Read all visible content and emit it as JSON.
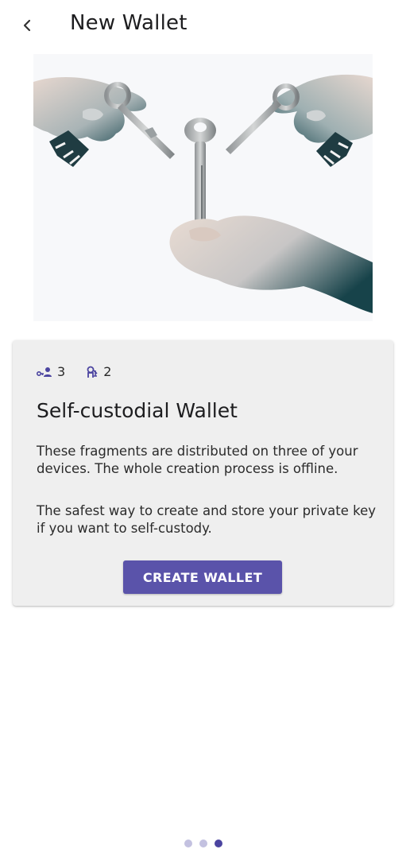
{
  "header": {
    "title": "New Wallet"
  },
  "card": {
    "stats": [
      {
        "icon": "key-person-icon",
        "value": "3"
      },
      {
        "icon": "signer-icon",
        "value": "2"
      }
    ],
    "title": "Self-custodial Wallet",
    "paragraph1": "These fragments are distributed on three of your devices. The whole creation process is offline.",
    "paragraph2": "The safest way to create and store your private key if you want to self-custody.",
    "create_label": "CREATE WALLET"
  },
  "pager": {
    "count": 3,
    "active_index": 2
  },
  "colors": {
    "accent": "#5a53aa",
    "dot_inactive": "#c3c1e0",
    "dot_active": "#4b44a0",
    "card_bg": "#efefef"
  }
}
